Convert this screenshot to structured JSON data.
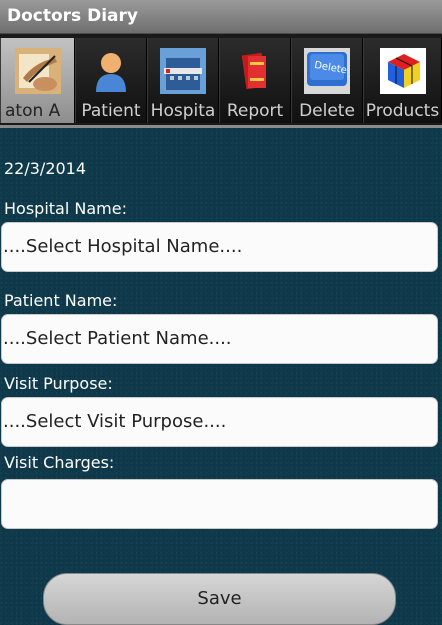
{
  "app": {
    "title": "Doctors Diary"
  },
  "tabs": [
    {
      "label": "aton   A",
      "icon": "signing-hand-icon"
    },
    {
      "label": "Patient",
      "icon": "person-icon"
    },
    {
      "label": "Hospita",
      "icon": "hospital-building-icon"
    },
    {
      "label": "Report",
      "icon": "books-icon"
    },
    {
      "label": "Delete",
      "icon": "delete-key-icon"
    },
    {
      "label": "Products",
      "icon": "rubiks-cube-icon"
    }
  ],
  "form": {
    "date": "22/3/2014",
    "hospital_label": "Hospital Name:",
    "hospital_value": "....Select Hospital Name....",
    "patient_label": "Patient Name:",
    "patient_value": "....Select Patient Name....",
    "purpose_label": "Visit Purpose:",
    "purpose_value": "....Select Visit Purpose....",
    "charges_label": "Visit Charges:",
    "charges_value": ""
  },
  "actions": {
    "save_label": "Save"
  }
}
